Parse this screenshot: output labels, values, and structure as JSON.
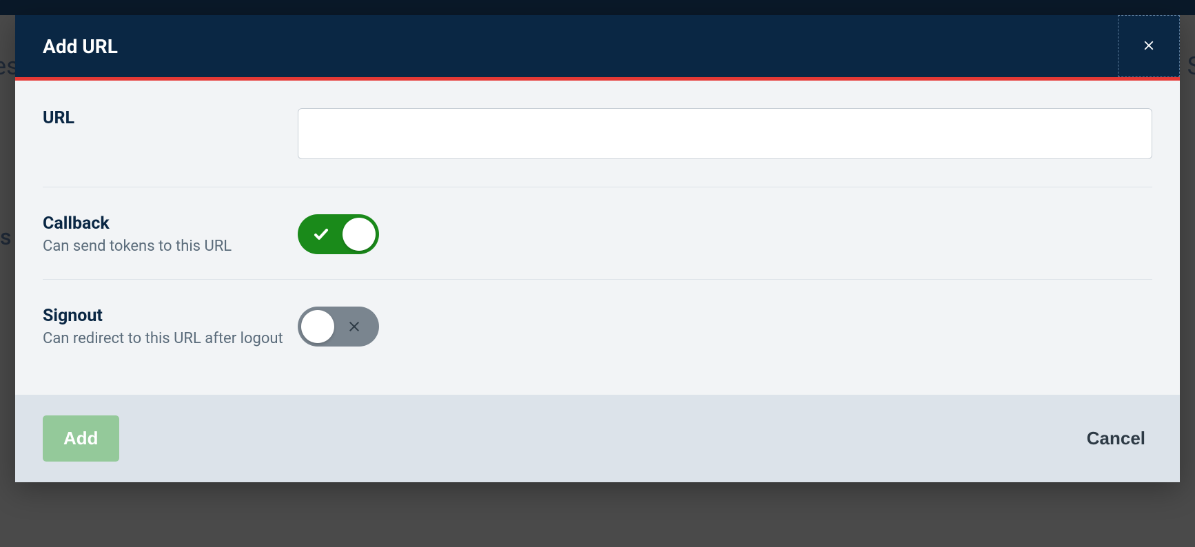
{
  "modal": {
    "title": "Add URL",
    "fields": {
      "url": {
        "label": "URL",
        "value": "",
        "placeholder": ""
      },
      "callback": {
        "label": "Callback",
        "hint": "Can send tokens to this URL",
        "enabled": true
      },
      "signout": {
        "label": "Signout",
        "hint": "Can redirect to this URL after logout",
        "enabled": false
      }
    },
    "actions": {
      "add": "Add",
      "cancel": "Cancel"
    }
  },
  "background": {
    "left_text": "es",
    "right_text": "S",
    "s_text": "s"
  }
}
